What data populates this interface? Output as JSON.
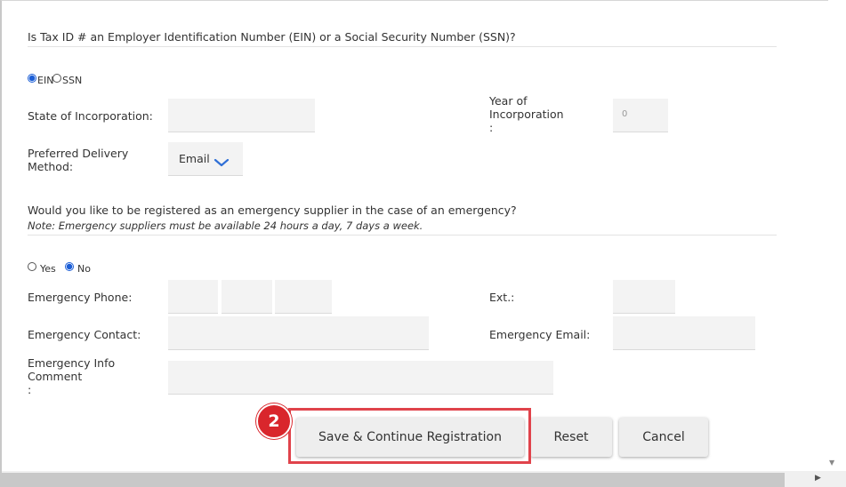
{
  "tax": {
    "question": "Is Tax ID # an Employer Identification Number (EIN) or a Social Security Number (SSN)?",
    "ein_label": "EIN",
    "ssn_label": "SSN",
    "selected": "EIN"
  },
  "incorporation": {
    "state_label": "State of Incorporation:",
    "state_value": "",
    "year_label_1": "Year of",
    "year_label_2": "Incorporation",
    "year_label_3": ":",
    "year_value": "0"
  },
  "delivery": {
    "label_1": "Preferred Delivery",
    "label_2": "Method:",
    "selected": "Email"
  },
  "emergency": {
    "question": "Would you like to be registered as an emergency supplier in the case of an emergency?",
    "note": "Note: Emergency suppliers must be available 24 hours a day, 7 days a week.",
    "yes_label": "Yes",
    "no_label": "No",
    "selected": "No",
    "phone_label": "Emergency Phone:",
    "ext_label": "Ext.:",
    "contact_label": "Emergency Contact:",
    "email_label": "Emergency Email:",
    "info_label_1": "Emergency Info",
    "info_label_2": "Comment",
    "info_label_3": ":"
  },
  "buttons": {
    "save": "Save & Continue Registration",
    "reset": "Reset",
    "cancel": "Cancel"
  },
  "annotation": {
    "step": "2",
    "highlight_color": "#e0434b",
    "badge_color": "#d9262c"
  }
}
